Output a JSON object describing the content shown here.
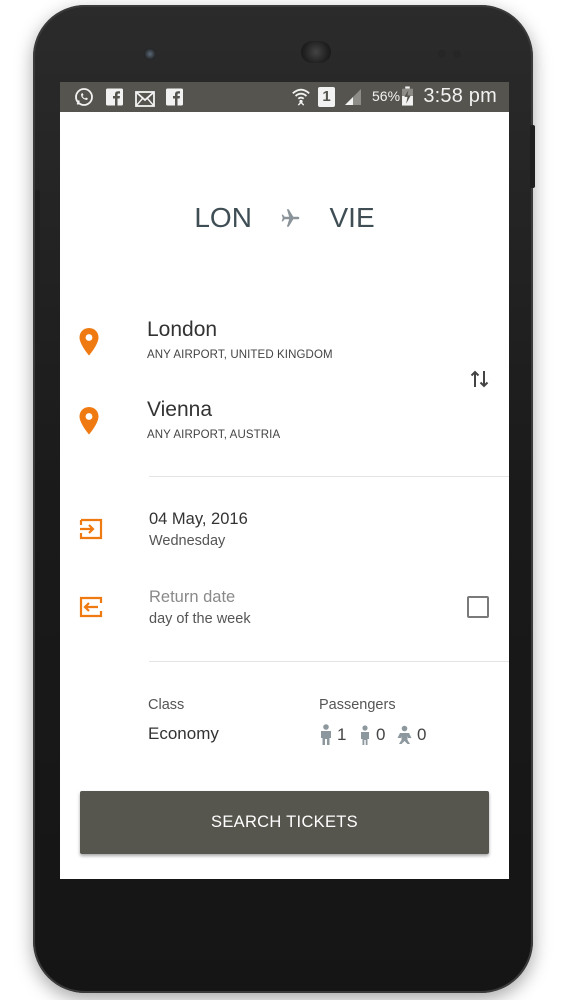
{
  "status_bar": {
    "battery_percent": "56%",
    "time": "3:58 pm",
    "sim_slot": "1",
    "notification_icons": [
      "whatsapp-icon",
      "facebook-icon",
      "mail-icon",
      "facebook-icon"
    ]
  },
  "route": {
    "from_code": "LON",
    "to_code": "VIE"
  },
  "origin": {
    "city": "London",
    "airport": "ANY AIRPORT, UNITED KINGDOM"
  },
  "destination": {
    "city": "Vienna",
    "airport": "ANY AIRPORT, AUSTRIA"
  },
  "departure": {
    "date": "04 May, 2016",
    "weekday": "Wednesday"
  },
  "return": {
    "date_placeholder": "Return date",
    "weekday_placeholder": "day of the week",
    "enabled": false
  },
  "class": {
    "label": "Class",
    "value": "Economy"
  },
  "passengers": {
    "label": "Passengers",
    "adults": "1",
    "children": "0",
    "infants": "0"
  },
  "search_button": {
    "label": "SEARCH TICKETS"
  },
  "colors": {
    "accent": "#f07a12",
    "status_bar": "#55544e",
    "button": "#56554e",
    "route_text": "#3f4e55"
  }
}
